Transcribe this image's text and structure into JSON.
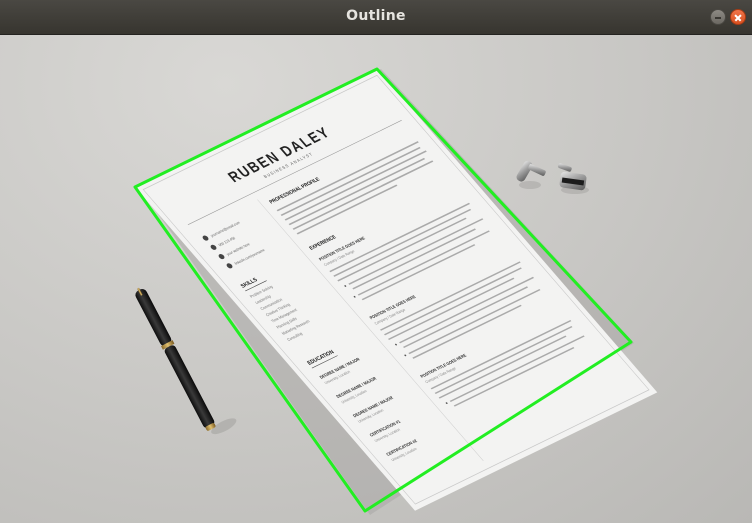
{
  "window": {
    "title": "Outline"
  },
  "colors": {
    "outline": "#22ee22",
    "desk": "#cfcecb",
    "paper": "#f3f3f2",
    "ink": "#222222",
    "close": "#e2572a"
  },
  "icons": {
    "minimize": "minimize-icon",
    "close": "close-icon"
  },
  "resume": {
    "name": "RUBEN DALEY",
    "subtitle": "BUSINESS ANALYST",
    "profile_heading": "PROFESSIONAL PROFILE",
    "experience_heading": "EXPERIENCE",
    "skills_heading": "SKILLS",
    "education_heading": "EDUCATION",
    "contact": [
      "yourname@email.com",
      "000 123 456",
      "your website here",
      "linkedin.com/yourname"
    ],
    "skills": [
      "Problem Solving",
      "Leadership",
      "Communication",
      "Creative Thinking",
      "Time Management",
      "Planning Skills",
      "Marketing Research",
      "Consulting"
    ],
    "jobs": [
      {
        "title": "POSITION TITLE GOES HERE",
        "company": "Company / Date Range"
      },
      {
        "title": "POSITION TITLE GOES HERE",
        "company": "Company / Date Range"
      },
      {
        "title": "POSITION TITLE GOES HERE",
        "company": "Company / Date Range"
      }
    ],
    "education": [
      {
        "degree": "DEGREE NAME / MAJOR",
        "school": "University, Location"
      },
      {
        "degree": "DEGREE NAME / MAJOR",
        "school": "University, Location"
      },
      {
        "degree": "DEGREE NAME / MAJOR",
        "school": "University, Location"
      },
      {
        "degree": "CERTIFICATION #1",
        "school": "University, Location"
      },
      {
        "degree": "CERTIFICATION #2",
        "school": "University, Location"
      }
    ]
  }
}
